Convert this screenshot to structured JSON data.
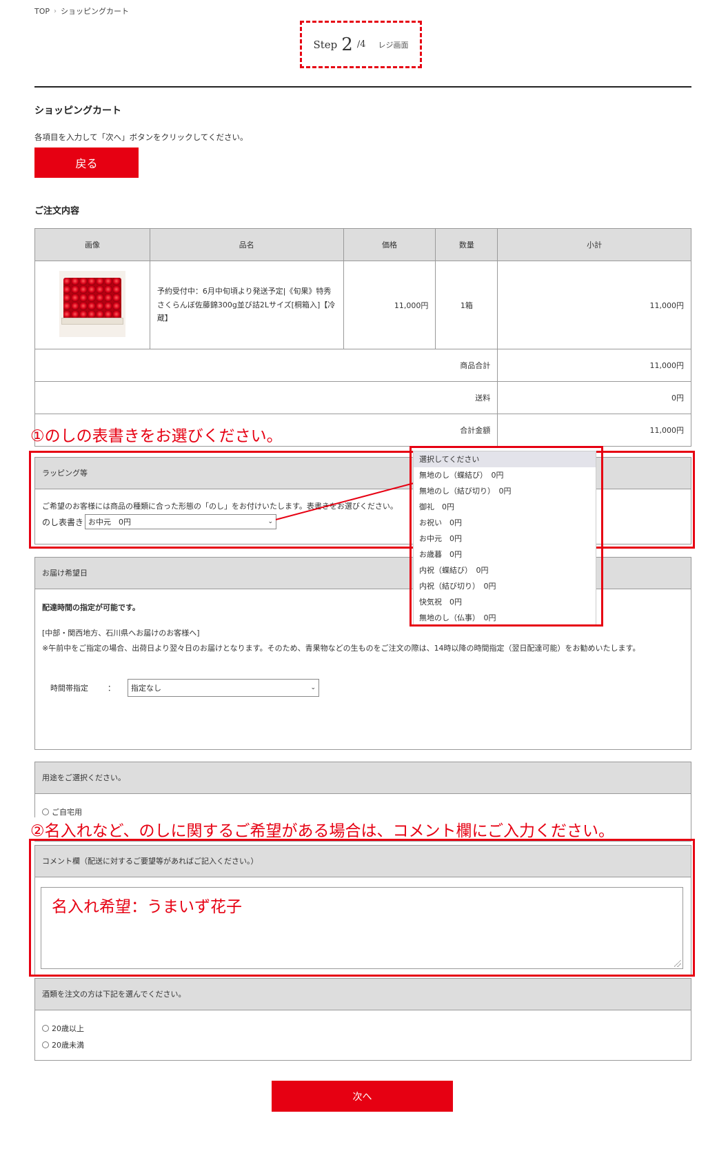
{
  "breadcrumb": {
    "home": "TOP",
    "separator": "›",
    "current": "ショッピングカート"
  },
  "step": {
    "word": "Step",
    "current": "2",
    "total": "/4",
    "name": "レジ画面"
  },
  "page": {
    "title": "ショッピングカート",
    "intro": "各項目を入力して「次へ」ボタンをクリックしてください。",
    "back_button": "戻る",
    "order_title": "ご注文内容"
  },
  "table": {
    "headers": {
      "image": "画像",
      "name": "品名",
      "price": "価格",
      "qty": "数量",
      "subtotal": "小計"
    },
    "item": {
      "name": "予約受付中：6月中旬頃より発送予定|《旬果》特秀さくらんぼ佐藤錦300g並び詰2Lサイズ[桐箱入]【冷蔵】",
      "price": "11,000円",
      "qty": "1箱",
      "subtotal": "11,000円"
    },
    "summary": {
      "goods_label": "商品合計",
      "goods_value": "11,000円",
      "shipping_label": "送料",
      "shipping_value": "0円",
      "total_label": "合計金額",
      "total_value": "11,000円"
    }
  },
  "annotations": {
    "one": "①のしの表書きをお選びください。",
    "two": "②名入れなど、のしに関するご希望がある場合は、コメント欄にご入力ください。"
  },
  "wrapping": {
    "header": "ラッピング等",
    "text": "ご希望のお客様には商品の種類に合った形態の「のし」をお付けいたします。表書きをお選びください。",
    "label": "のし表書き",
    "selected": "お中元　0円"
  },
  "dropdown_options": [
    "選択してください",
    "無地のし（蝶結び）　0円",
    "無地のし（結び切り）　0円",
    "御礼　0円",
    "お祝い　0円",
    "お中元　0円",
    "お歳暮　0円",
    "内祝（蝶結び）　0円",
    "内祝（結び切り）　0円",
    "快気祝　0円",
    "無地のし（仏事）　0円"
  ],
  "delivery": {
    "header": "お届け希望日",
    "bold": "配達時間の指定が可能です。",
    "region": "[中部・関西地方、石川県へお届けのお客様へ]",
    "note": "※午前中をご指定の場合、出荷日より翌々日のお届けとなります。そのため、青果物などの生ものをご注文の際は、14時以降の時間指定（翌日配達可能）をお勧めいたします。",
    "time_label": "時間帯指定",
    "colon": "：",
    "time_selected": "指定なし"
  },
  "usage": {
    "header": "用途をご選択ください。",
    "option1": "ご自宅用"
  },
  "comment": {
    "header": "コメント欄（配送に対するご要望等があればご記入ください。）",
    "value": "名入れ希望：うまいず花子"
  },
  "alcohol": {
    "header": "酒類を注文の方は下記を選んでください。",
    "option1": "20歳以上",
    "option2": "20歳未満"
  },
  "next_button": "次へ",
  "colors": {
    "accent": "#e60012",
    "header_gray": "#dddddd"
  }
}
